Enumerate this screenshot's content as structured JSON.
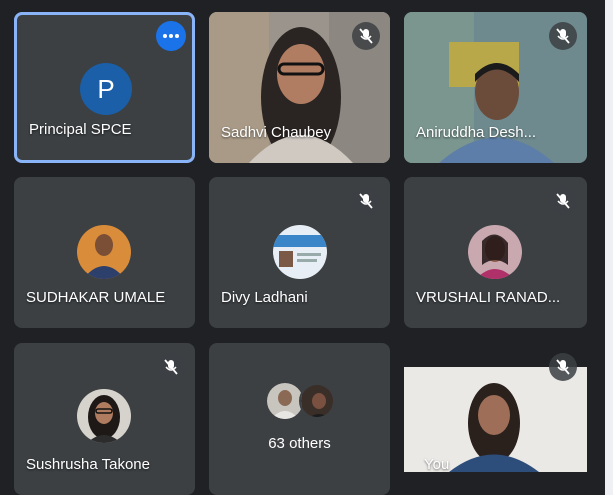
{
  "participants": [
    {
      "name": "Principal SPCE",
      "avatar_letter": "P"
    },
    {
      "name": "Sadhvi Chaubey"
    },
    {
      "name": "Aniruddha Desh..."
    },
    {
      "name": "SUDHAKAR UMALE"
    },
    {
      "name": "Divy Ladhani"
    },
    {
      "name": "VRUSHALI RANAD..."
    },
    {
      "name": "Sushrusha Takone"
    },
    {
      "name": "You"
    }
  ],
  "others": {
    "label": "63 others"
  },
  "colors": {
    "background": "#202124",
    "tile": "#3c4043",
    "active_border": "#8ab4f8",
    "more_button": "#1a73e8"
  }
}
